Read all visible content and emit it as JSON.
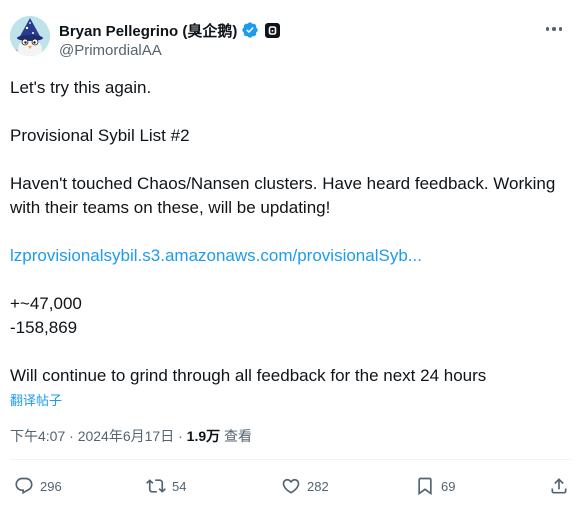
{
  "author": {
    "display_name": "Bryan Pellegrino (臭企鹅)",
    "handle": "@PrimordialAA"
  },
  "tweet": {
    "lines": [
      "Let's try this again.",
      "Provisional Sybil List #2",
      "Haven't touched Chaos/Nansen clusters. Have heard feedback. Working",
      "with their teams on these, will be updating!",
      "lzprovisionalsybil.s3.amazonaws.com/provisionalSyb...",
      "+~47,000",
      "-158,869",
      "Will continue to grind through all feedback for the next 24 hours"
    ],
    "translate_label": "翻译帖子"
  },
  "meta": {
    "time": "下午4:07",
    "separator": "·",
    "date": "2024年6月17日",
    "views_count": "1.9万",
    "views_label": "查看"
  },
  "actions": {
    "replies": "296",
    "reposts": "54",
    "likes": "282",
    "bookmarks": "69"
  },
  "colors": {
    "text": "#0f1419",
    "secondary": "#536471",
    "link": "#1d9bf0",
    "verified": "#1d9bf0"
  }
}
